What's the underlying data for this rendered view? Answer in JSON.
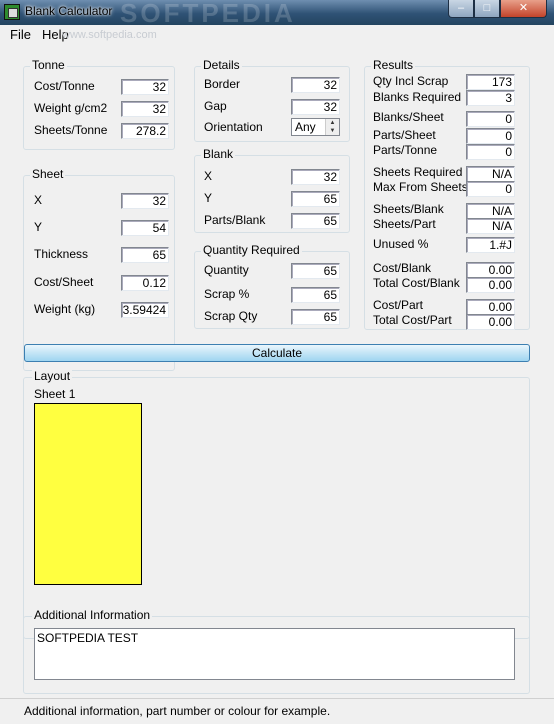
{
  "window": {
    "title": "Blank Calculator",
    "watermark": "SOFTPEDIA",
    "menu_watermark": "www.softpedia.com"
  },
  "menu": [
    "File",
    "Help"
  ],
  "tonne": {
    "title": "Tonne",
    "fields": [
      {
        "label": "Cost/Tonne",
        "value": "32"
      },
      {
        "label": "Weight g/cm2",
        "value": "32"
      },
      {
        "label": "Sheets/Tonne",
        "value": "278.2"
      }
    ]
  },
  "sheet": {
    "title": "Sheet",
    "fields": [
      {
        "label": "X",
        "value": "32"
      },
      {
        "label": "Y",
        "value": "54"
      },
      {
        "label": "Thickness",
        "value": "65"
      },
      {
        "label": "Cost/Sheet",
        "value": "0.12"
      },
      {
        "label": "Weight (kg)",
        "value": "3.59424"
      }
    ]
  },
  "details": {
    "title": "Details",
    "border_label": "Border",
    "border_value": "32",
    "gap_label": "Gap",
    "gap_value": "32",
    "orientation_label": "Orientation",
    "orientation_value": "Any"
  },
  "blank": {
    "title": "Blank",
    "fields": [
      {
        "label": "X",
        "value": "32"
      },
      {
        "label": "Y",
        "value": "65"
      },
      {
        "label": "Parts/Blank",
        "value": "65"
      }
    ]
  },
  "quantity": {
    "title": "Quantity Required",
    "fields": [
      {
        "label": "Quantity",
        "value": "65"
      },
      {
        "label": "Scrap %",
        "value": "65"
      },
      {
        "label": "Scrap Qty",
        "value": "65"
      }
    ]
  },
  "results": {
    "title": "Results",
    "fields": [
      {
        "label": "Qty Incl Scrap",
        "value": "173"
      },
      {
        "label": "Blanks Required",
        "value": "3"
      },
      {
        "label": "Blanks/Sheet",
        "value": "0"
      },
      {
        "label": "Parts/Sheet",
        "value": "0"
      },
      {
        "label": "Parts/Tonne",
        "value": "0"
      },
      {
        "label": "Sheets Required",
        "value": "N/A"
      },
      {
        "label": "Max From Sheets",
        "value": "0"
      },
      {
        "label": "Sheets/Blank",
        "value": "N/A"
      },
      {
        "label": "Sheets/Part",
        "value": "N/A"
      },
      {
        "label": "Unused %",
        "value": "1.#J"
      },
      {
        "label": "Cost/Blank",
        "value": "0.00"
      },
      {
        "label": "Total Cost/Blank",
        "value": "0.00"
      },
      {
        "label": "Cost/Part",
        "value": "0.00"
      },
      {
        "label": "Total Cost/Part",
        "value": "0.00"
      }
    ]
  },
  "calculate_label": "Calculate",
  "layout": {
    "title": "Layout",
    "sheet_label": "Sheet 1",
    "sheet_color": "#ffff40"
  },
  "additional": {
    "title": "Additional Information",
    "text": "SOFTPEDIA TEST"
  },
  "status_text": "Additional information, part number or colour for example."
}
